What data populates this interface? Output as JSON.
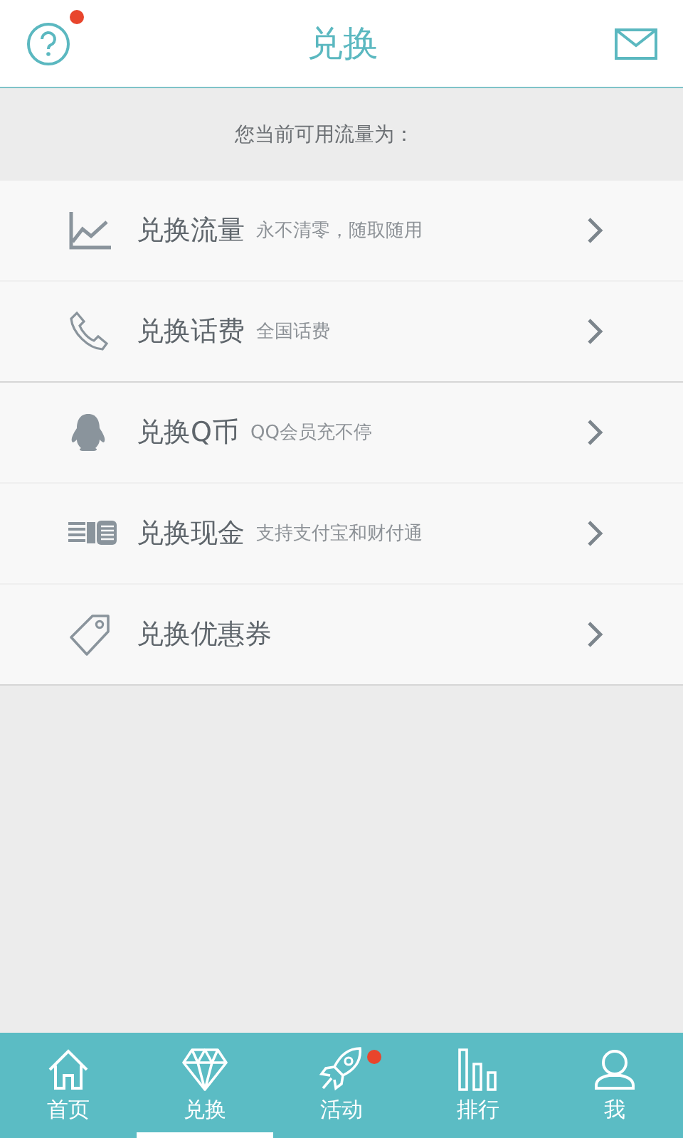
{
  "header": {
    "title": "兑换",
    "help_badge": true
  },
  "balance": {
    "label": "您当前可用流量为："
  },
  "groups": [
    {
      "items": [
        {
          "label": "兑换流量",
          "note": "永不清零，随取随用"
        },
        {
          "label": "兑换话费",
          "note": "全国话费"
        }
      ]
    },
    {
      "items": [
        {
          "label": "兑换Q币",
          "note": "QQ会员充不停"
        },
        {
          "label": "兑换现金",
          "note": "支持支付宝和财付通"
        },
        {
          "label": "兑换优惠券"
        }
      ]
    }
  ],
  "tabs": [
    {
      "label": "首页",
      "selected": false,
      "badge": false
    },
    {
      "label": "兑换",
      "selected": true,
      "badge": false
    },
    {
      "label": "活动",
      "selected": false,
      "badge": true
    },
    {
      "label": "排行",
      "selected": false,
      "badge": false
    },
    {
      "label": "我",
      "selected": false,
      "badge": false
    }
  ]
}
